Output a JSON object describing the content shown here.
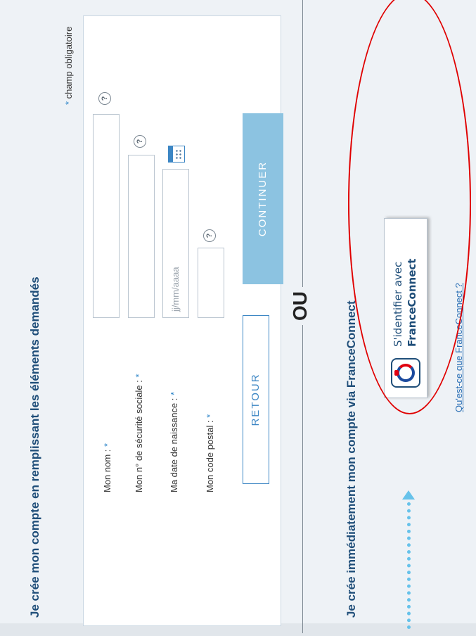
{
  "signup": {
    "title": "Je crée mon compte en remplissant les éléments demandés",
    "required_note_star": "*",
    "required_note_text": "champ obligatoire",
    "fields": [
      {
        "label": "Mon nom :",
        "star": "*",
        "value": "",
        "help": "?"
      },
      {
        "label": "Mon n° de sécurité sociale :",
        "star": "*",
        "value": "",
        "help": "?"
      },
      {
        "label": "Ma date de naissance :",
        "star": "*",
        "placeholder": "jj/mm/aaaa",
        "icon": "calendar-icon"
      },
      {
        "label": "Mon code postal :",
        "star": "*",
        "value": "",
        "help": "?"
      }
    ],
    "back_button": "RETOUR",
    "continue_button": "CONTINUER"
  },
  "separator": {
    "text": "OU"
  },
  "franceconnect": {
    "title": "Je crée immédiatement mon compte via FranceConnect",
    "button_line1": "S'identifier avec",
    "button_line2": "FranceConnect",
    "button_icon": "franceconnect-logo-icon",
    "link": "Qu'est-ce que FranceConnect ?"
  },
  "annotations": {
    "ellipse_color": "#e00000",
    "arrow_color": "#66c2ea"
  }
}
